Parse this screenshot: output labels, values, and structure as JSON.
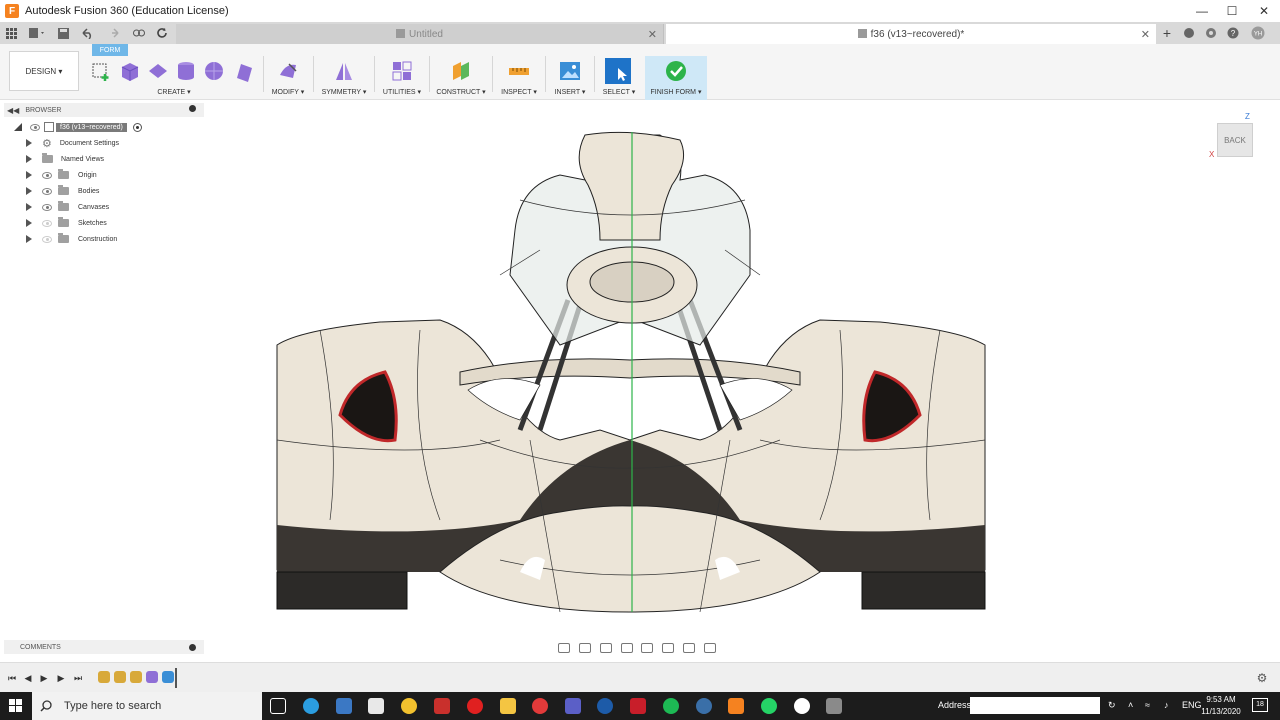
{
  "window": {
    "title": "Autodesk Fusion 360 (Education License)",
    "app_badge": "F"
  },
  "tabs": [
    {
      "label": "Untitled",
      "active": false
    },
    {
      "label": "f36 (v13~recovered)*",
      "active": true
    }
  ],
  "toolbar": {
    "workspace_tab": "FORM",
    "workspace_dropdown": "DESIGN ▾",
    "groups": [
      {
        "label": "CREATE ▾"
      },
      {
        "label": "MODIFY ▾"
      },
      {
        "label": "SYMMETRY ▾"
      },
      {
        "label": "UTILITIES ▾"
      },
      {
        "label": "CONSTRUCT ▾"
      },
      {
        "label": "INSPECT ▾"
      },
      {
        "label": "INSERT ▾"
      },
      {
        "label": "SELECT ▾"
      },
      {
        "label": "FINISH FORM ▾"
      }
    ]
  },
  "browser": {
    "header": "BROWSER",
    "root": "f36 (v13~recovered)",
    "items": [
      {
        "label": "Document Settings",
        "icon": "gear-icon"
      },
      {
        "label": "Named Views",
        "icon": "folder-icon"
      },
      {
        "label": "Origin",
        "icon": "folder-icon",
        "visible": true
      },
      {
        "label": "Bodies",
        "icon": "folder-icon",
        "visible": true
      },
      {
        "label": "Canvases",
        "icon": "folder-icon",
        "visible": true
      },
      {
        "label": "Sketches",
        "icon": "folder-icon",
        "visible": false
      },
      {
        "label": "Construction",
        "icon": "folder-icon",
        "visible": false
      }
    ]
  },
  "viewcube": {
    "face": "BACK",
    "axis_z": "Z",
    "axis_x": "X"
  },
  "comments": {
    "header": "COMMENTS"
  },
  "taskbar": {
    "search_placeholder": "Type here to search",
    "address_label": "Address",
    "lang": "ENG",
    "time": "9:53 AM",
    "date": "11/13/2020",
    "notif_count": "18"
  },
  "colors": {
    "accent": "#0696d7",
    "finish_form": "#2db34a",
    "form_tab": "#6fb7e8",
    "body_fill": "#ece5d8",
    "highlight_red": "#c0282a"
  }
}
